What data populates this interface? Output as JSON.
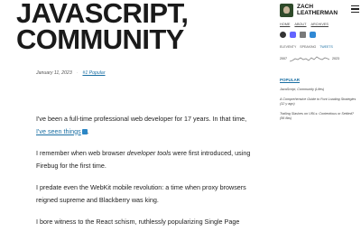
{
  "post": {
    "title_line1": "JAVASCRIPT,",
    "title_line2": "COMMUNITY",
    "date": "January 11, 2023",
    "separator": "·",
    "tag": "#1 Popular"
  },
  "article": {
    "p1_text": "I've been a full-time professional web developer for 17 years. In that time, ",
    "p1_link": "I've seen things",
    "p1_end": ".",
    "p2_start": "I remember when web browser ",
    "p2_em": "developer tools",
    "p2_end": " were first introduced, using Firebug for the first time.",
    "p3": "I predate even the WebKit mobile revolution: a time when proxy browsers reigned supreme and Blackberry was king.",
    "p4": "I bore witness to the React schism, ruthlessly popularizing Single Page"
  },
  "sidebar": {
    "brand_line1": "ZACH",
    "brand_line2": "LEATHERMAN",
    "nav": [
      "HOME",
      "ABOUT",
      "ARCHIVES"
    ],
    "social_icons": [
      "github-icon",
      "mastodon-icon",
      "database-icon",
      "mastodon-alt-icon"
    ],
    "links": [
      "ELEVENTY",
      "SPEAKING",
      "TWEETS"
    ],
    "spark_start": "2007",
    "spark_end": "2023",
    "popular_label": "POPULAR",
    "popular": [
      "JavaScript, Community (Lifes)",
      "A Comprehensive Guide to Font Loading Strategies (12 y ago)",
      "Trailing Slashes on URLs: Contentious or Settled? (56 libs)"
    ]
  },
  "colors": {
    "accent": "#1a6fa3",
    "avatar_bg": "#2e4a2a"
  }
}
